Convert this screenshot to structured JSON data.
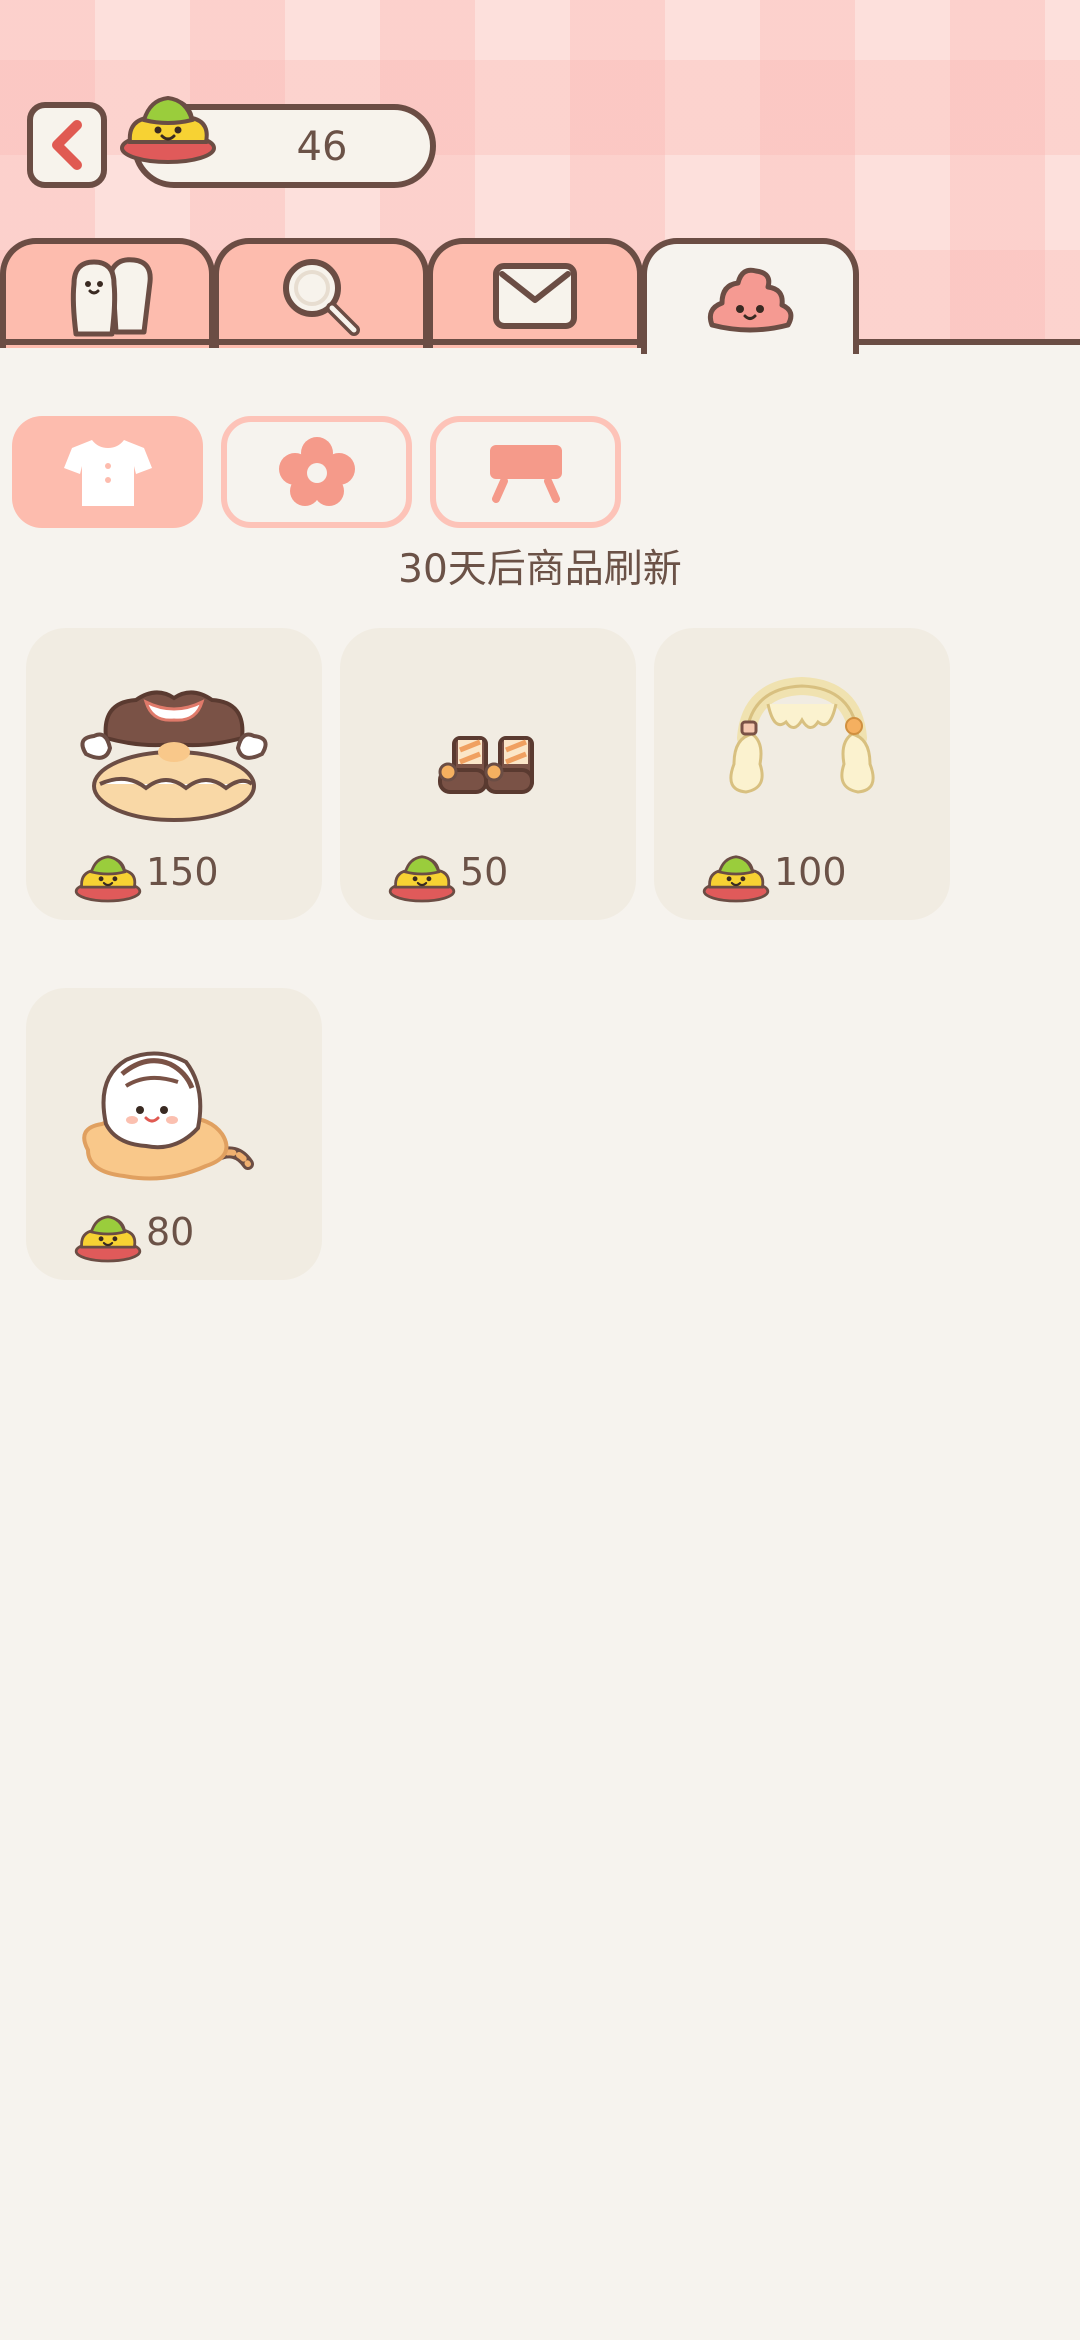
{
  "currency": {
    "amount": "46",
    "icon": "poop-coin-icon"
  },
  "tabs": [
    {
      "name": "friends",
      "icon": "friends-icon",
      "active": false
    },
    {
      "name": "search",
      "icon": "magnifier-icon",
      "active": false
    },
    {
      "name": "mail",
      "icon": "envelope-icon",
      "active": false
    },
    {
      "name": "shop",
      "icon": "poop-icon",
      "active": true
    }
  ],
  "categories": [
    {
      "name": "clothing",
      "icon": "shirt-icon",
      "active": true
    },
    {
      "name": "flower",
      "icon": "flower-icon",
      "active": false
    },
    {
      "name": "furniture",
      "icon": "table-icon",
      "active": false
    }
  ],
  "refresh_notice": "30天后商品刷新",
  "shop_items": [
    {
      "icon": "cream-puff-outfit",
      "price": "150"
    },
    {
      "icon": "striped-boots",
      "price": "50"
    },
    {
      "icon": "cream-hair-buns",
      "price": "100"
    },
    {
      "icon": "marshmallow-cookie-hat",
      "price": "80"
    }
  ],
  "colors": {
    "accent": "#fdbcae",
    "outline": "#6b4d44",
    "background": "#f6f3ee",
    "card": "#f1ece2",
    "back_arrow": "#e05a52"
  }
}
